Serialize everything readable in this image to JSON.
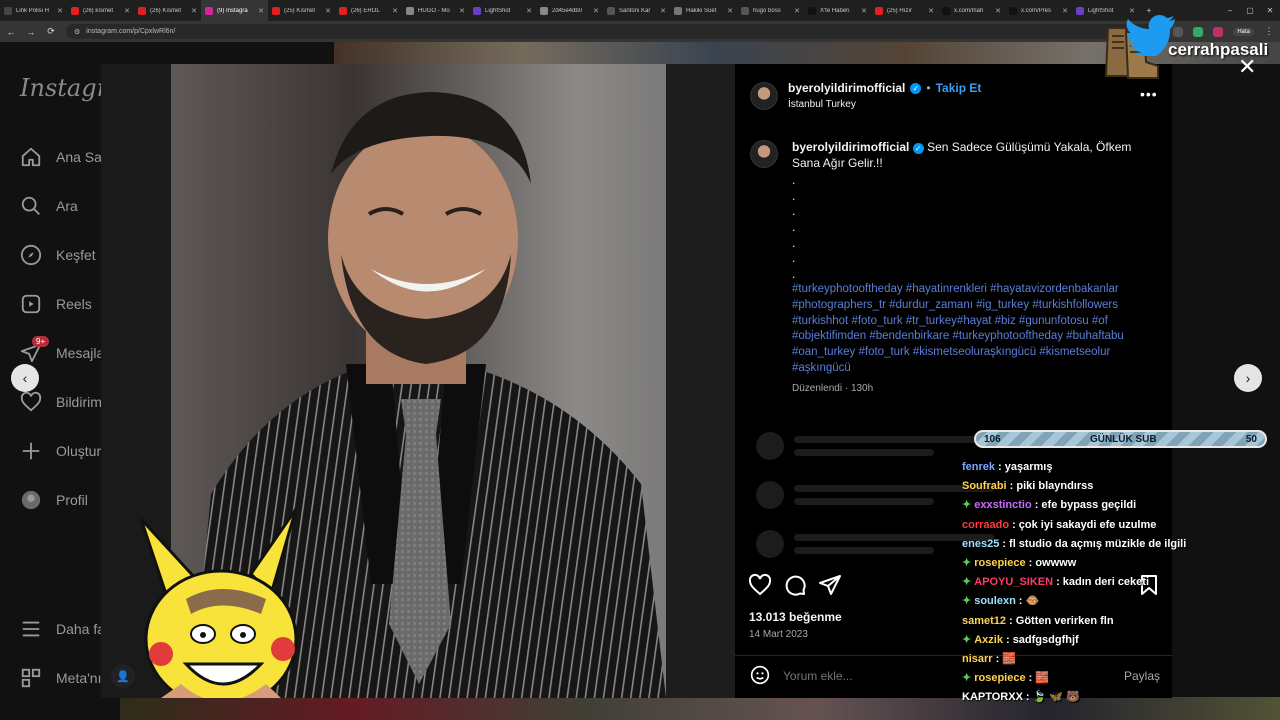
{
  "browser": {
    "tabs": [
      {
        "title": "Link Polisi H",
        "color": "#444",
        "active": false
      },
      {
        "title": "(26) kısmet",
        "color": "#e02020",
        "active": false
      },
      {
        "title": "(26) Kısmet",
        "color": "#e02020",
        "active": false
      },
      {
        "title": "(9) Instagra",
        "color": "#d6249f",
        "active": true
      },
      {
        "title": "(25) Kısmet",
        "color": "#e02020",
        "active": false
      },
      {
        "title": "(26) EROL",
        "color": "#e02020",
        "active": false
      },
      {
        "title": "HUGO - Mo",
        "color": "#888",
        "active": false
      },
      {
        "title": "LightShot",
        "color": "#6a3ec2",
        "active": false
      },
      {
        "title": "2d45e4db0",
        "color": "#888",
        "active": false
      },
      {
        "title": "Santoni Kar",
        "color": "#555",
        "active": false
      },
      {
        "title": "Hakiki Süet",
        "color": "#777",
        "active": false
      },
      {
        "title": "hugo boss",
        "color": "#555",
        "active": false
      },
      {
        "title": "X'te Haberi",
        "color": "#111",
        "active": false
      },
      {
        "title": "(25) Hızır",
        "color": "#e02020",
        "active": false
      },
      {
        "title": "x.com/mah",
        "color": "#111",
        "active": false
      },
      {
        "title": "x.com/Pres",
        "color": "#111",
        "active": false
      },
      {
        "title": "LightShot",
        "color": "#6a3ec2",
        "active": false
      }
    ],
    "new_tab": "+",
    "url": "instagram.com/p/CpxlwRl6n/",
    "profile_badge": "Hata"
  },
  "sidebar": {
    "logo": "Instagram",
    "items": [
      {
        "label": "Ana Sayfa",
        "icon": "home-icon"
      },
      {
        "label": "Ara",
        "icon": "search-icon"
      },
      {
        "label": "Keşfet",
        "icon": "explore-icon"
      },
      {
        "label": "Reels",
        "icon": "reels-icon"
      },
      {
        "label": "Mesajlar",
        "icon": "messages-icon",
        "badge": "9+"
      },
      {
        "label": "Bildirimler",
        "icon": "heart-icon"
      },
      {
        "label": "Oluştur",
        "icon": "plus-icon"
      },
      {
        "label": "Profil",
        "icon": "profile-icon"
      }
    ],
    "more": "Daha fazla",
    "meta": "Meta'nın"
  },
  "post": {
    "username": "byerolyildirimofficial",
    "follow": "Takip Et",
    "location": "İstanbul Turkey",
    "more_options": "•••",
    "caption_text": "Sen Sadece Gülüşümü Yakala, Öfkem Sana Ağır Gelir.!!",
    "dots": [
      ".",
      ".",
      ".",
      ".",
      ".",
      ".",
      "."
    ],
    "hashtags": "#turkeyphotooftheday #hayatinrenkleri #hayatavizordenbakanlar #photographers_tr #durdur_zamanı #ig_turkey #turkishfollowers #turkishhot #foto_turk #tr_turkey#hayat #biz #gununfotosu #of #objektifimden #bendenbirkare #turkeyphotooftheday #buhaftabu #oan_turkey #foto_turk #kismetseoluraşkıngücü #kismetseolur #aşkıngücü",
    "edited": "Düzenlendi",
    "age": "130h",
    "likes": "13.013 beğenme",
    "date": "14 Mart 2023",
    "comment_placeholder": "Yorum ekle...",
    "post_button": "Paylaş"
  },
  "modal": {
    "close": "✕",
    "prev": "‹",
    "next": "›"
  },
  "stream": {
    "twitter_handle": "cerrahpasali",
    "sub_goal": {
      "current": "106",
      "label": "GÜNLÜK SUB",
      "target": "50"
    },
    "chat": [
      {
        "user": "fenrek",
        "color": "#7aa7ff",
        "msg": ": yaşarmış",
        "spark": false
      },
      {
        "user": "Soufrabi",
        "color": "#ffd34d",
        "msg": ": piki blayndırss",
        "spark": false
      },
      {
        "user": "exxstinctio",
        "color": "#c86bff",
        "msg": ": efe bypass geçildi",
        "spark": true
      },
      {
        "user": "corraado",
        "color": "#ff3b3b",
        "msg": ": çok iyi sakaydi efe uzulme",
        "spark": false
      },
      {
        "user": "enes25",
        "color": "#9fe0ff",
        "msg": ": fl studio da açmış müzikle de ilgili",
        "spark": false
      },
      {
        "user": "rosepiece",
        "color": "#ffd34d",
        "msg": ": owwww",
        "spark": true
      },
      {
        "user": "APOYU_SIKEN",
        "color": "#ff3b6a",
        "msg": ": kadın deri ceketi",
        "spark": true
      },
      {
        "user": "soulexn",
        "color": "#9fe0ff",
        "msg": ": 🐵",
        "spark": true
      },
      {
        "user": "samet12",
        "color": "#ffd34d",
        "msg": ": Götten verirken fln",
        "spark": false
      },
      {
        "user": "Axzik",
        "color": "#ffd34d",
        "msg": ": sadfgsdgfhjf",
        "spark": true
      },
      {
        "user": "nisarr",
        "color": "#ffd34d",
        "msg": ": 🧱",
        "spark": false
      },
      {
        "user": "rosepiece",
        "color": "#ffd34d",
        "msg": ": 🧱",
        "spark": true
      },
      {
        "user": "KAPTORXX",
        "color": "#ffffff",
        "msg": ": 🍃 🦋 🐻",
        "spark": false
      }
    ]
  }
}
